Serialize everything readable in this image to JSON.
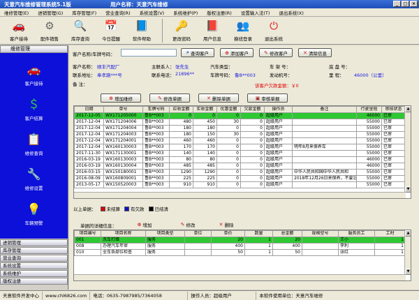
{
  "window": {
    "title": "天意汽车维修管理系统5.1版",
    "user_label": "用户名称：天意汽车维修"
  },
  "menu": [
    "维修管理(E)",
    "进销管理(G)",
    "库存管理(F)",
    "营业查询(R)",
    "系统设置(V)",
    "系统维护(P)",
    "版权注册(R)",
    "设置输入法(T)",
    "退出系统(X)"
  ],
  "toolbar": [
    {
      "label": "客户接待",
      "icon": "car-icon"
    },
    {
      "label": "配件销售",
      "icon": "parts-icon"
    },
    {
      "label": "库存查询",
      "icon": "magnifier-icon"
    },
    {
      "label": "今日提醒",
      "icon": "calendar-icon"
    },
    {
      "label": "软件帮助",
      "icon": "help-book-icon"
    },
    {
      "label": "更改密码",
      "icon": "key-icon"
    },
    {
      "label": "用户信息",
      "icon": "user-book-icon"
    },
    {
      "label": "换班登录",
      "icon": "switch-user-icon"
    },
    {
      "label": "退出系统",
      "icon": "exit-icon"
    }
  ],
  "sidebar": {
    "header": "维修管理",
    "items": [
      {
        "label": "客户接待",
        "icon": "car-icon"
      },
      {
        "label": "客户结算",
        "icon": "settle-icon"
      },
      {
        "label": "维修查询",
        "icon": "search-doc-icon"
      },
      {
        "label": "维修设置",
        "icon": "settings-icon"
      },
      {
        "label": "车辆预警",
        "icon": "lightbulb-icon"
      }
    ],
    "groups": [
      "进销管理",
      "库存管理",
      "营业查询",
      "系统设置",
      "系统维护",
      "版权注册"
    ]
  },
  "search": {
    "label": "客户名称/车牌号码：",
    "value": "",
    "buttons": [
      "查询客户",
      "添加客户",
      "修改客户",
      "清除信息"
    ]
  },
  "customer": {
    "name_label": "客户名称：",
    "name": "顺丰汽配厂",
    "contact_label": "主联系人：",
    "contact": "张先生",
    "cartype_label": "汽车类型：",
    "cartype": "",
    "frame_label": "车 架 号：",
    "frame": "",
    "fuel_label": "底 盘 号：",
    "fuel": "",
    "addr_label": "联系地址：",
    "addr": "奉孝路***号",
    "phone_label": "联系电话：",
    "phone": "21896**",
    "plate_label": "车牌号码：",
    "plate": "鲁B**003",
    "engine_label": "发动机号：",
    "engine": "",
    "mileage_label": "里 程：",
    "mileage": "46000（公里）",
    "remark_label": "备 注：",
    "remark": "",
    "debt": "该客户欠款金额：￥0"
  },
  "actions": [
    "增加维修",
    "修改单据",
    "删除单据",
    "审核单据"
  ],
  "grid1": {
    "columns": [
      "日期",
      "单号",
      "车牌号码",
      "应收金额",
      "实收金额",
      "优惠金额",
      "欠款金额",
      "操作员",
      "备注",
      "行驶里程",
      "审核状态"
    ],
    "rows": [
      [
        "2017-12-05",
        "WX171205000",
        "鲁B**003",
        "0",
        "0",
        "0",
        "0",
        "超级用户",
        "",
        "46000",
        "已审"
      ],
      [
        "2017-12-04",
        "WX171204006",
        "鲁B**003",
        "480",
        "450",
        "30",
        "0",
        "超级用户",
        "",
        "55000",
        "已审"
      ],
      [
        "2017-12-04",
        "WX171204004",
        "鲁B**003",
        "180",
        "180",
        "0",
        "0",
        "超级用户",
        "",
        "55000",
        "已审"
      ],
      [
        "2017-12-04",
        "WX171204003",
        "鲁B**003",
        "180",
        "150",
        "30",
        "0",
        "超级用户",
        "",
        "55000",
        "已审"
      ],
      [
        "2017-12-04",
        "WX171204001",
        "鲁B**003",
        "460",
        "460",
        "0",
        "0",
        "超级用户",
        "",
        "55000",
        "已审"
      ],
      [
        "2017-12-04",
        "WX160130003",
        "鲁B**003",
        "170",
        "170",
        "0",
        "0",
        "超级用户",
        "明年8月来保养车",
        "55000",
        "已审"
      ],
      [
        "2017-11-30",
        "WX171130001",
        "鲁B**003",
        "140",
        "140",
        "0",
        "0",
        "超级用户",
        "",
        "55000",
        "已审"
      ],
      [
        "2016-03-19",
        "WX160130003",
        "鲁B**003",
        "80",
        "80",
        "0",
        "0",
        "超级用户",
        "",
        "46000",
        "已审"
      ],
      [
        "2016-03-19",
        "WX160130004",
        "鲁B**003",
        "485",
        "485",
        "0",
        "0",
        "超级用户",
        "",
        "46000",
        "已审"
      ],
      [
        "2016-03-15",
        "WX150180001",
        "鲁B**003",
        "1290",
        "1290",
        "0",
        "0",
        "超级用户",
        "中华人民共和国中华人民共和",
        "55000",
        "已审"
      ],
      [
        "2016-08-09",
        "WX160809001",
        "鲁B**003",
        "225",
        "225",
        "0",
        "0",
        "超级用户",
        "2018年12月26日来保养，不要忘记",
        "55000",
        "已审"
      ],
      [
        "2013-05-17",
        "WX150520003",
        "鲁B**003",
        "910",
        "910",
        "0",
        "0",
        "超级用户",
        "",
        "55000",
        "已审"
      ]
    ]
  },
  "legend": {
    "prefix": "以上单据：",
    "items": [
      {
        "label": "未结算",
        "color": "#e00000"
      },
      {
        "label": "有欠款",
        "color": "#1010c0"
      },
      {
        "label": "已结清",
        "color": "#000000"
      }
    ]
  },
  "detail": {
    "title": "单据的详细信息：",
    "buttons": [
      "增加",
      "修改",
      "删除"
    ],
    "columns": [
      "项目编号",
      "项目名称",
      "项目类型",
      "单位",
      "单价",
      "数量",
      "总金额",
      "规格型号",
      "服务员工",
      "工时"
    ],
    "rows": [
      [
        "001",
        "洗车打蜡",
        "服务",
        "",
        "20",
        "1",
        "20",
        "",
        "王小",
        "1"
      ],
      [
        "008",
        "办理汽车年审",
        "服务",
        "",
        "400",
        "1",
        "400",
        "",
        "李利",
        "1"
      ],
      [
        "010",
        "全车各部位检查",
        "服务",
        "",
        "50",
        "1",
        "50",
        "",
        "张红",
        "1"
      ]
    ]
  },
  "status": [
    "天意软件开发中心",
    "www.chl6826.com",
    "电话：0635-7987985/7364058",
    "操作人员：超级用户",
    "本软件使用单位：天意汽车维修"
  ],
  "colors": {
    "accent": "#0c10d8",
    "selected_row": "#2ec832",
    "debt_text": "#e00000"
  }
}
